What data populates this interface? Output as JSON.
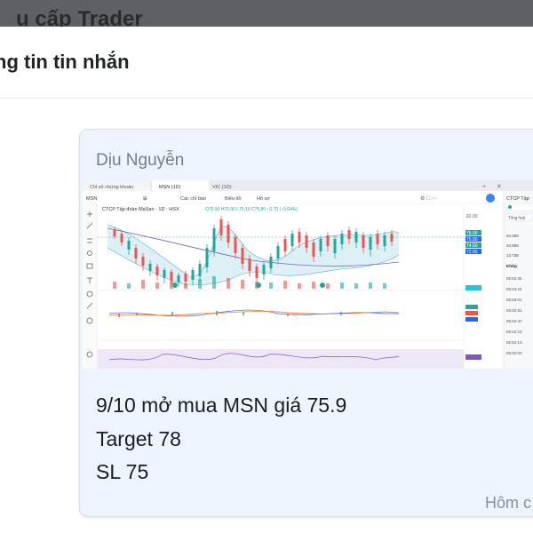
{
  "backdrop": {
    "title": "u cấp Trader"
  },
  "modal": {
    "title": "ng tin tin nhắn"
  },
  "message": {
    "sender": "Dịu Nguyễn",
    "lines": [
      "9/10 mở mua MSN giá 75.9",
      "Target 78",
      "SL 75"
    ],
    "time": "Hôm c"
  },
  "attachment": {
    "tabs": [
      "Chỉ số chứng khoán",
      "MSN (1D)",
      "VIC (1D)"
    ],
    "symbol_search": "MSN",
    "chart_title": "CTCP Tập đoàn MaSan · 1D · HSX",
    "ohlc": "O75.90 H76.00 L75.10 C75.80 −0.70 (−0.64%)",
    "toolbar_items": [
      "Các chỉ báo",
      "Biểu đồ",
      "Hồ sơ"
    ],
    "price_labels": [
      "82.00",
      "76.00",
      "75.80",
      "74.60",
      "72.00"
    ],
    "side_panel": {
      "title": "CTCP Tập",
      "tab": "Tổng hợp",
      "values": [
        "34.306",
        "34.608",
        "13.738"
      ],
      "section": "Khớp",
      "times": [
        "05:53:35",
        "05:53:24",
        "05:53:01",
        "05:52:51",
        "05:52:47",
        "05:52:23",
        "05:52:13",
        "05:52:03"
      ]
    }
  }
}
